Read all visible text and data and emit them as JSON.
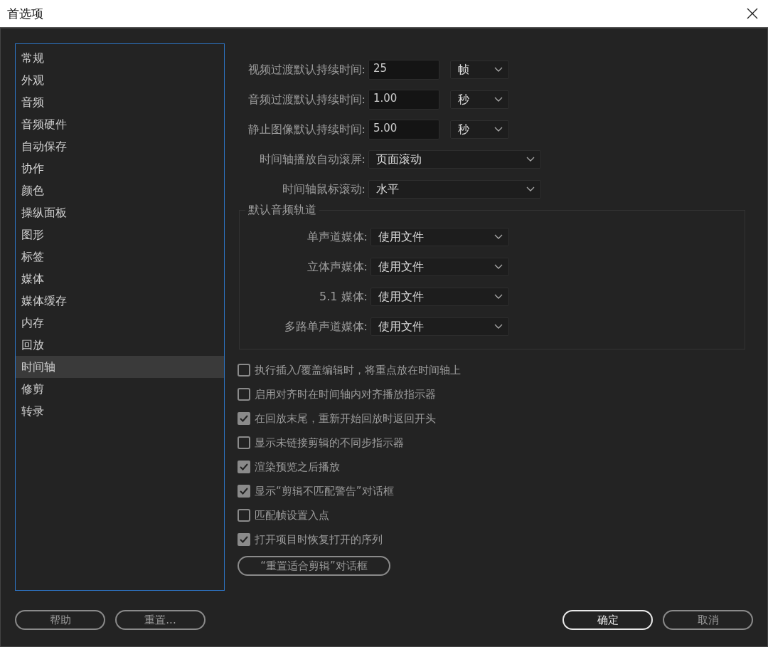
{
  "window": {
    "title": "首选项"
  },
  "sidebar": {
    "items": [
      {
        "label": "常规",
        "selected": false
      },
      {
        "label": "外观",
        "selected": false
      },
      {
        "label": "音频",
        "selected": false
      },
      {
        "label": "音频硬件",
        "selected": false
      },
      {
        "label": "自动保存",
        "selected": false
      },
      {
        "label": "协作",
        "selected": false
      },
      {
        "label": "颜色",
        "selected": false
      },
      {
        "label": "操纵面板",
        "selected": false
      },
      {
        "label": "图形",
        "selected": false
      },
      {
        "label": "标签",
        "selected": false
      },
      {
        "label": "媒体",
        "selected": false
      },
      {
        "label": "媒体缓存",
        "selected": false
      },
      {
        "label": "内存",
        "selected": false
      },
      {
        "label": "回放",
        "selected": false
      },
      {
        "label": "时间轴",
        "selected": true
      },
      {
        "label": "修剪",
        "selected": false
      },
      {
        "label": "转录",
        "selected": false
      }
    ]
  },
  "duration_fields": [
    {
      "label": "视频过渡默认持续时间:",
      "value": "25",
      "unit": "帧"
    },
    {
      "label": "音频过渡默认持续时间:",
      "value": "1.00",
      "unit": "秒"
    },
    {
      "label": "静止图像默认持续时间:",
      "value": "5.00",
      "unit": "秒"
    }
  ],
  "scroll_settings": [
    {
      "label": "时间轴播放自动滚屏:",
      "value": "页面滚动"
    },
    {
      "label": "时间轴鼠标滚动:",
      "value": "水平"
    }
  ],
  "audio_tracks": {
    "title": "默认音频轨道",
    "rows": [
      {
        "label": "单声道媒体:",
        "value": "使用文件"
      },
      {
        "label": "立体声媒体:",
        "value": "使用文件"
      },
      {
        "label": "5.1 媒体:",
        "value": "使用文件"
      },
      {
        "label": "多路单声道媒体:",
        "value": "使用文件"
      }
    ]
  },
  "options": [
    {
      "label": "执行插入/覆盖编辑时，将重点放在时间轴上",
      "checked": false
    },
    {
      "label": "启用对齐时在时间轴内对齐播放指示器",
      "checked": false
    },
    {
      "label": "在回放末尾，重新开始回放时返回开头",
      "checked": true
    },
    {
      "label": "显示未链接剪辑的不同步指示器",
      "checked": false
    },
    {
      "label": "渲染预览之后播放",
      "checked": true
    },
    {
      "label": "显示“剪辑不匹配警告”对话框",
      "checked": true
    },
    {
      "label": "匹配帧设置入点",
      "checked": false
    },
    {
      "label": "打开项目时恢复打开的序列",
      "checked": true
    }
  ],
  "reset_dialog_button": "“重置适合剪辑”对话框",
  "footer_buttons": [
    {
      "label": "帮助",
      "default": false
    },
    {
      "label": "重置...",
      "default": false
    },
    {
      "label": "确定",
      "default": true
    },
    {
      "label": "取消",
      "default": false
    }
  ]
}
